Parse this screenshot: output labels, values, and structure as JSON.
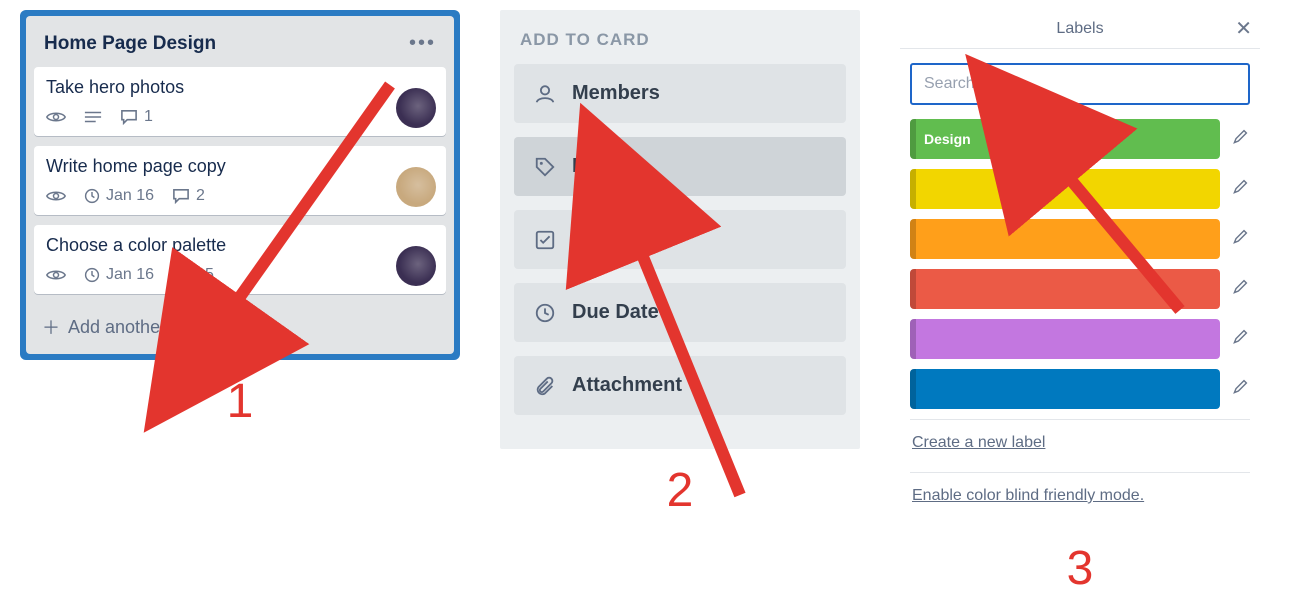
{
  "step_numbers": [
    "1",
    "2",
    "3"
  ],
  "list": {
    "title": "Home Page Design",
    "add_card_label": "Add another card",
    "cards": [
      {
        "title": "Take hero photos",
        "watch": true,
        "has_desc": true,
        "comments": "1",
        "due": null,
        "avatar": "purple"
      },
      {
        "title": "Write home page copy",
        "watch": true,
        "has_desc": false,
        "comments": "2",
        "due": "Jan 16",
        "avatar": "light"
      },
      {
        "title": "Choose a color palette",
        "watch": true,
        "has_desc": false,
        "comments": "25",
        "due": "Jan 16",
        "avatar": "purple"
      }
    ]
  },
  "add_to_card": {
    "heading": "ADD TO CARD",
    "items": [
      {
        "label": "Members",
        "icon": "person",
        "active": false
      },
      {
        "label": "Labels",
        "icon": "tag",
        "active": true
      },
      {
        "label": "Checklist",
        "icon": "check",
        "active": false
      },
      {
        "label": "Due Date",
        "icon": "clock",
        "active": false
      },
      {
        "label": "Attachment",
        "icon": "clip",
        "active": false
      }
    ]
  },
  "labels_popover": {
    "title": "Labels",
    "search_placeholder": "Search labels…",
    "labels": [
      {
        "name": "Design",
        "color": "#61bd4f"
      },
      {
        "name": "",
        "color": "#f2d600"
      },
      {
        "name": "",
        "color": "#ff9f1a"
      },
      {
        "name": "",
        "color": "#eb5a46"
      },
      {
        "name": "",
        "color": "#c377e0"
      },
      {
        "name": "",
        "color": "#0079bf"
      }
    ],
    "create_label": "Create a new label",
    "colorblind_label": "Enable color blind friendly mode."
  }
}
